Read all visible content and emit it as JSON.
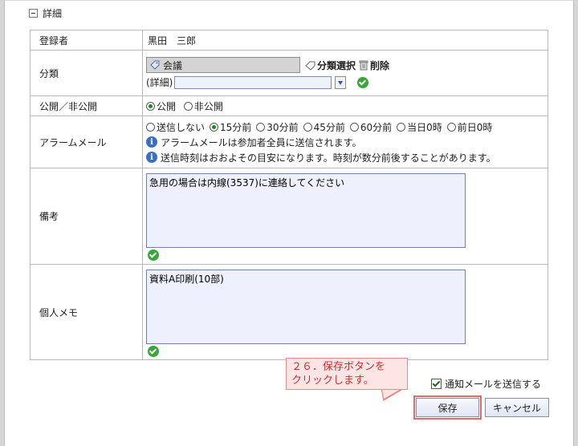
{
  "section": {
    "title": "詳細"
  },
  "rows": {
    "registrant": {
      "label": "登録者",
      "value": "黒田　三郎"
    },
    "category": {
      "label": "分類",
      "tag": "会議",
      "select_label": "分類選択",
      "delete_label": "削除",
      "detail_label": "(詳細)",
      "detail_value": ""
    },
    "visibility": {
      "label": "公開／非公開",
      "options": [
        "公開",
        "非公開"
      ],
      "selected": "公開"
    },
    "alarm": {
      "label": "アラームメール",
      "options": [
        "送信しない",
        "15分前",
        "30分前",
        "45分前",
        "60分前",
        "当日0時",
        "前日0時"
      ],
      "selected": "15分前",
      "info1": "アラームメールは参加者全員に送信されます。",
      "info2": "送信時刻はおおよその目安になります。時刻が数分前後することがあります。"
    },
    "remarks": {
      "label": "備考",
      "value": "急用の場合は内線(3537)に連絡してください"
    },
    "memo": {
      "label": "個人メモ",
      "value": "資料A印刷(10部)"
    }
  },
  "notify": {
    "label": "通知メールを送信する",
    "checked": true
  },
  "buttons": {
    "save": "保存",
    "cancel": "キャンセル"
  },
  "callout": {
    "line1": "２６．保存ボタンを",
    "line2": "クリックします。"
  },
  "colors": {
    "callout_text": "#c23030",
    "callout_bg": "#fde5e5",
    "highlight": "#e06a6a",
    "ok_green": "#3aa53a"
  }
}
